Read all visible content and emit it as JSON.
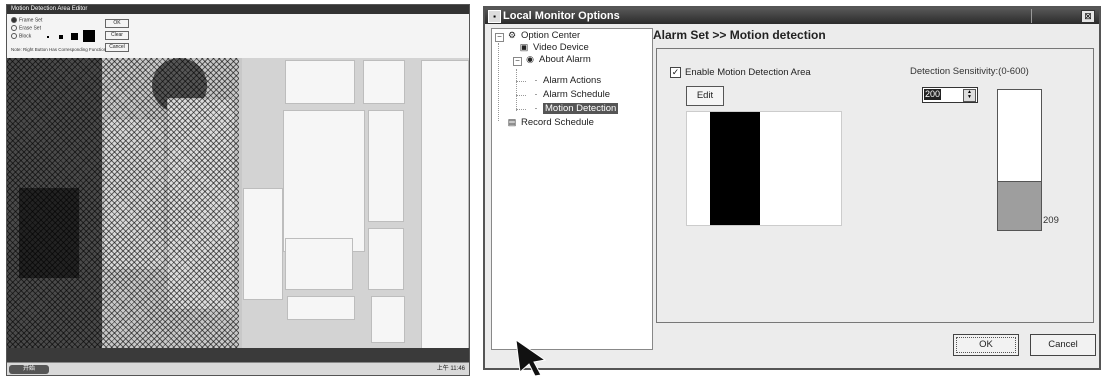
{
  "left_window": {
    "title": "Motion Detection Area Editor",
    "options": [
      "Frame Set",
      "Erase Set",
      "Block"
    ],
    "buttons": [
      "OK",
      "Clear",
      "Cancel"
    ],
    "note": "Note: Right Button Has Corresponding Function",
    "start_label": "开始",
    "tray_time": "上午 11:46"
  },
  "dialog": {
    "title": "Local Monitor Options",
    "close_glyph": "⊠",
    "tree": {
      "option_center": "Option Center",
      "video_device": "Video Device",
      "about_alarm": "About Alarm",
      "alarm_actions": "Alarm Actions",
      "alarm_schedule": "Alarm Schedule",
      "motion_detection": "Motion Detection",
      "record_schedule": "Record Schedule"
    },
    "header": "Alarm Set >> Motion detection",
    "enable_label": "Enable Motion Detection Area",
    "enable_checked": true,
    "edit_label": "Edit",
    "sensitivity_label": "Detection Sensitivity:(0-600)",
    "sensitivity_value": "200",
    "gauge_value": "209",
    "gauge_level": 0.34,
    "ok_label": "OK",
    "cancel_label": "Cancel"
  }
}
